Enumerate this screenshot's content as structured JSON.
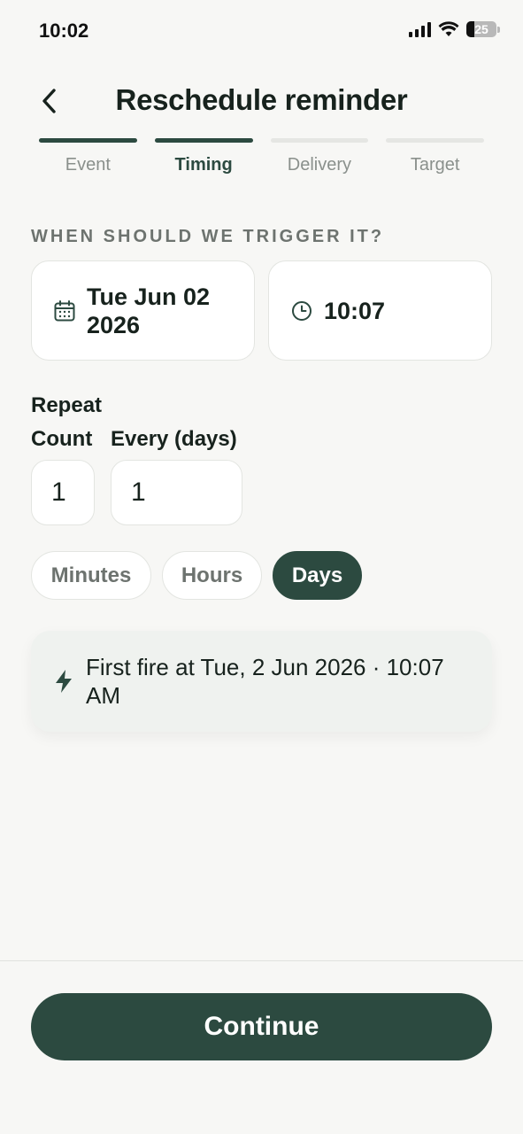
{
  "status_bar": {
    "time": "10:02",
    "battery": "25"
  },
  "header": {
    "title": "Reschedule reminder",
    "back_icon": "chevron-left-icon"
  },
  "stepper": {
    "steps": [
      {
        "label": "Event",
        "state": "done"
      },
      {
        "label": "Timing",
        "state": "active"
      },
      {
        "label": "Delivery",
        "state": "pending"
      },
      {
        "label": "Target",
        "state": "pending"
      }
    ]
  },
  "trigger": {
    "section_label": "WHEN SHOULD WE TRIGGER IT?",
    "date": "Tue Jun 02 2026",
    "time": "10:07"
  },
  "repeat": {
    "label": "Repeat",
    "count_label": "Count",
    "count_value": "1",
    "every_label": "Every (days)",
    "every_value": "1",
    "units": [
      "Minutes",
      "Hours",
      "Days"
    ],
    "selected_unit": "Days"
  },
  "info": {
    "text": "First fire at Tue, 2 Jun 2026 · 10:07 AM"
  },
  "footer": {
    "continue_label": "Continue"
  },
  "colors": {
    "accent": "#2c4a40",
    "background": "#f7f7f5"
  }
}
